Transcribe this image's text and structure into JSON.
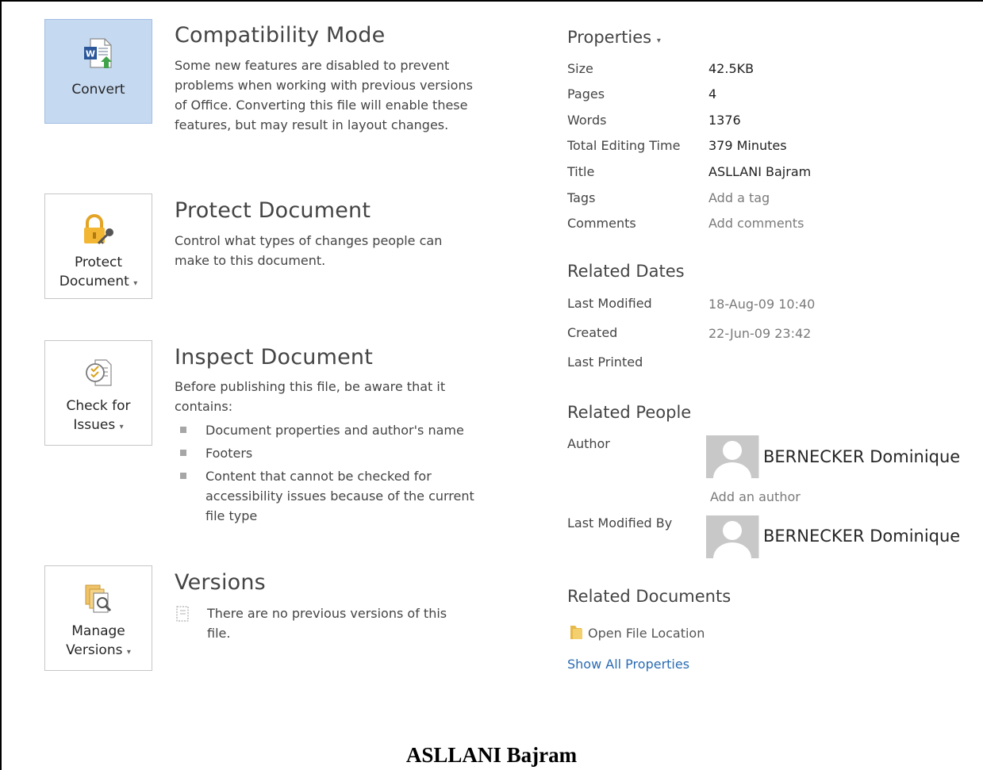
{
  "left": {
    "compatibility": {
      "button_label": "Convert",
      "title": "Compatibility Mode",
      "description": "Some new features are disabled to prevent problems when working with previous versions of Office. Converting this file will enable these features, but may result in layout changes."
    },
    "protect": {
      "button_line1": "Protect",
      "button_line2": "Document",
      "title": "Protect Document",
      "description": "Control what types of changes people can make to this document."
    },
    "inspect": {
      "button_line1": "Check for",
      "button_line2": "Issues",
      "title": "Inspect Document",
      "description": "Before publishing this file, be aware that it contains:",
      "items": [
        "Document properties and author's name",
        "Footers",
        "Content that cannot be checked for accessibility issues because of the current file type"
      ]
    },
    "versions": {
      "button_line1": "Manage",
      "button_line2": "Versions",
      "title": "Versions",
      "description": "There are no previous versions of this file."
    }
  },
  "properties": {
    "heading": "Properties",
    "caret": "▾",
    "rows": [
      {
        "label": "Size",
        "value": "42.5KB"
      },
      {
        "label": "Pages",
        "value": "4"
      },
      {
        "label": "Words",
        "value": "1376"
      },
      {
        "label": "Total Editing Time",
        "value": "379 Minutes"
      },
      {
        "label": "Title",
        "value": "ASLLANI Bajram"
      },
      {
        "label": "Tags",
        "value": "Add a tag"
      },
      {
        "label": "Comments",
        "value": "Add comments"
      }
    ]
  },
  "related_dates": {
    "heading": "Related Dates",
    "rows": [
      {
        "label": "Last Modified",
        "value": "18-Aug-09 10:40"
      },
      {
        "label": "Created",
        "value": "22-Jun-09 23:42"
      },
      {
        "label": "Last Printed",
        "value": ""
      }
    ]
  },
  "related_people": {
    "heading": "Related People",
    "author_label": "Author",
    "author_name": "BERNECKER Dominique",
    "add_author": "Add an author",
    "last_modified_by_label": "Last Modified By",
    "last_modified_by_name": "BERNECKER Dominique"
  },
  "related_documents": {
    "heading": "Related Documents",
    "open_location": "Open File Location",
    "show_all": "Show All Properties"
  },
  "footer_title": "ASLLANI Bajram",
  "colors": {
    "accent_tile": "#c5d9f1",
    "link": "#2a6bb3",
    "word_blue": "#2b579a"
  }
}
